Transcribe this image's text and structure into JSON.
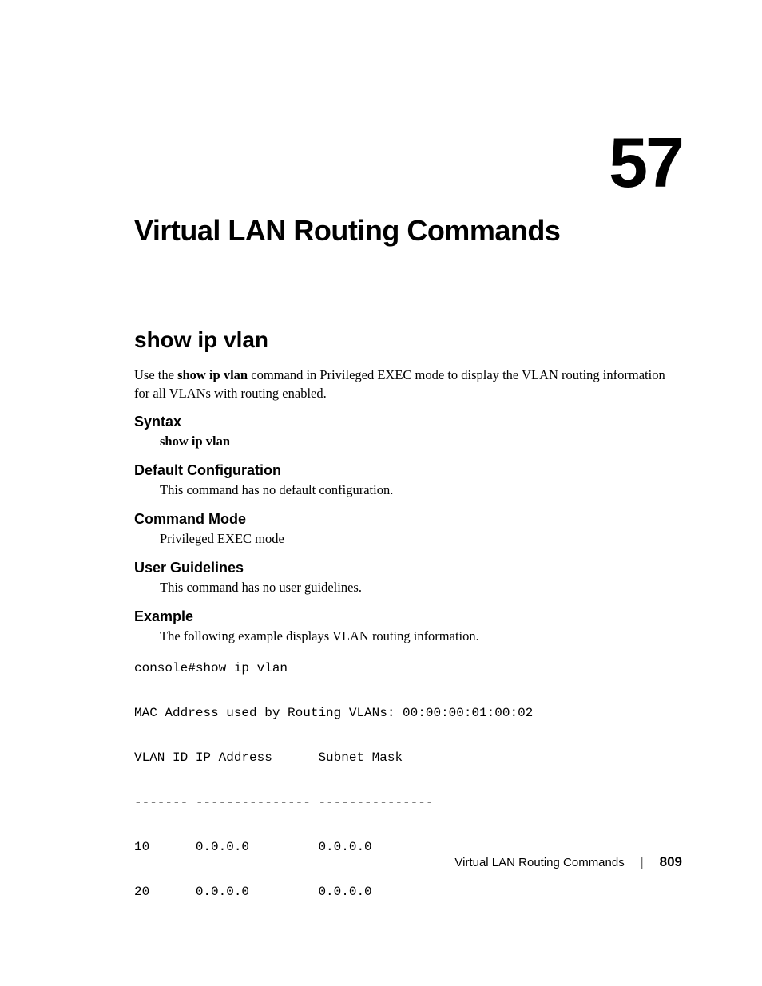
{
  "chapter": {
    "number": "57",
    "title": "Virtual LAN Routing Commands"
  },
  "section": {
    "title": "show ip vlan",
    "intro_pre": "Use the ",
    "intro_bold": "show ip vlan",
    "intro_post": " command in Privileged EXEC mode to display the VLAN routing information for all VLANs with routing enabled."
  },
  "syntax": {
    "heading": "Syntax",
    "command": "show ip vlan"
  },
  "default_config": {
    "heading": "Default Configuration",
    "text": "This command has no default configuration."
  },
  "command_mode": {
    "heading": "Command Mode",
    "text": "Privileged EXEC mode"
  },
  "user_guidelines": {
    "heading": "User Guidelines",
    "text": "This command has no user guidelines."
  },
  "example": {
    "heading": "Example",
    "text": "The following example displays VLAN routing information.",
    "code": "console#show ip vlan\n\nMAC Address used by Routing VLANs: 00:00:00:01:00:02\n\nVLAN ID IP Address      Subnet Mask\n\n------- --------------- ---------------\n\n10      0.0.0.0         0.0.0.0\n\n20      0.0.0.0         0.0.0.0"
  },
  "footer": {
    "title": "Virtual LAN Routing Commands",
    "separator": "|",
    "page": "809"
  }
}
